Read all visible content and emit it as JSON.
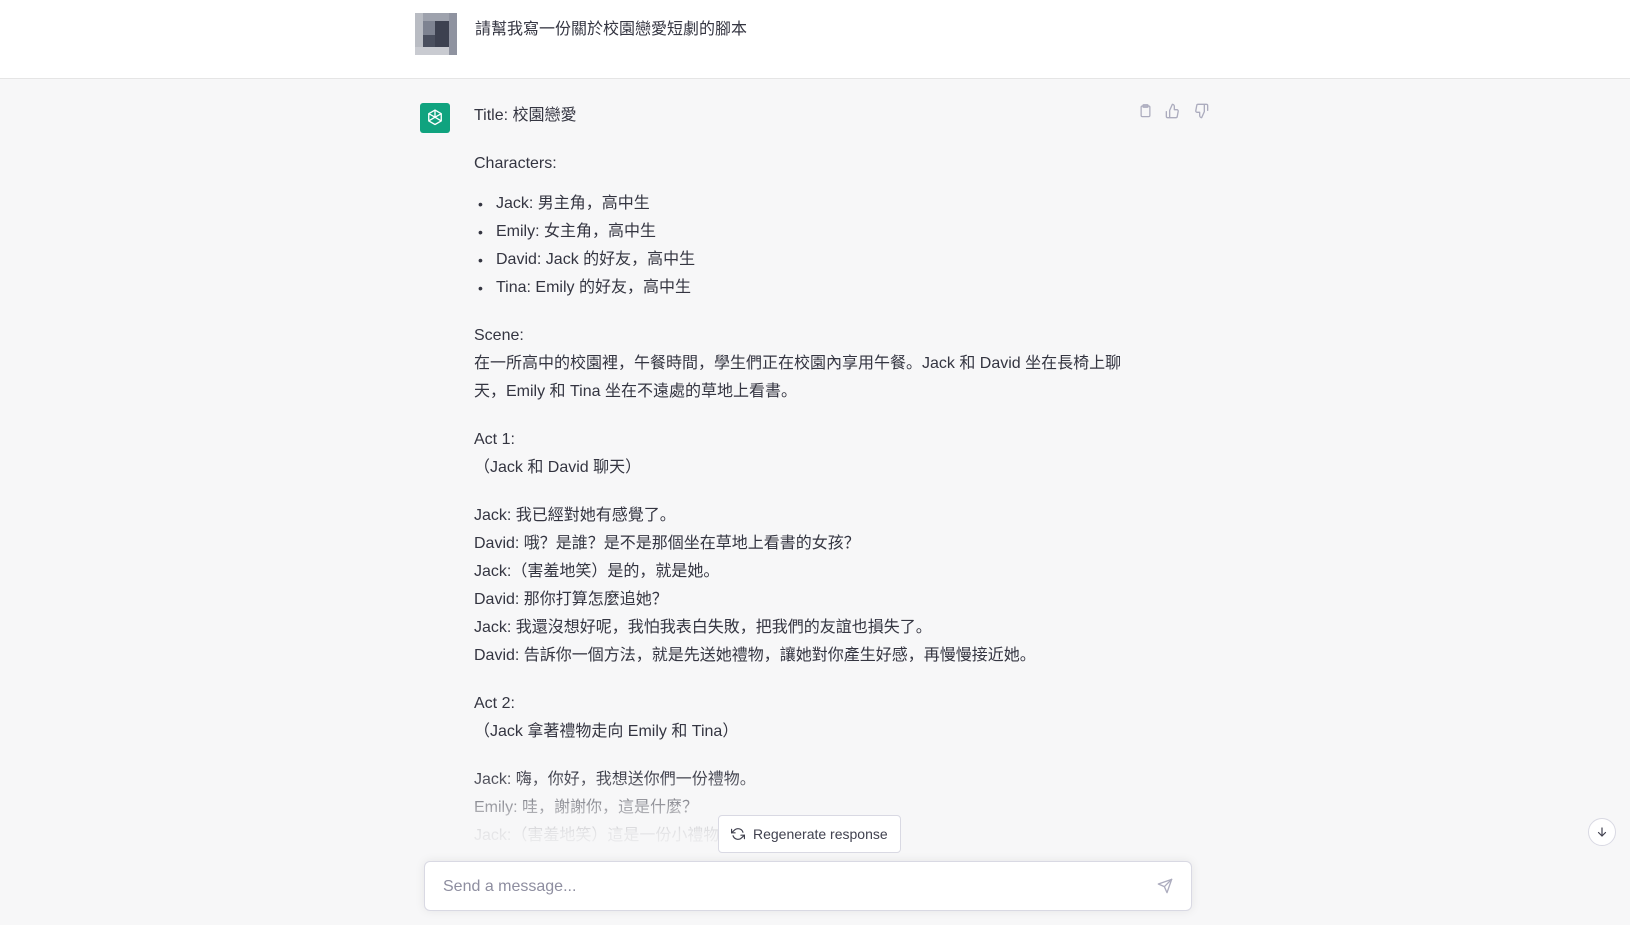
{
  "user_message": {
    "text": "請幫我寫一份關於校園戀愛短劇的腳本"
  },
  "assistant_message": {
    "title_line": "Title: 校園戀愛",
    "characters_heading": "Characters:",
    "characters": [
      "Jack: 男主角，高中生",
      "Emily: 女主角，高中生",
      "David: Jack 的好友，高中生",
      "Tina: Emily 的好友，高中生"
    ],
    "scene_heading": "Scene:",
    "scene_line1": "在一所高中的校園裡，午餐時間，學生們正在校園內享用午餐。Jack 和 David 坐在長椅上聊",
    "scene_line2": "天，Emily 和 Tina 坐在不遠處的草地上看書。",
    "act1_heading": "Act 1:",
    "act1_direction": "（Jack 和 David 聊天）",
    "act1_lines": [
      "Jack: 我已經對她有感覺了。",
      "David: 哦？是誰？是不是那個坐在草地上看書的女孩？",
      "Jack:（害羞地笑）是的，就是她。",
      "David: 那你打算怎麼追她？",
      "Jack: 我還沒想好呢，我怕我表白失敗，把我們的友誼也損失了。",
      "David: 告訴你一個方法，就是先送她禮物，讓她對你產生好感，再慢慢接近她。"
    ],
    "act2_heading": "Act 2:",
    "act2_direction": "（Jack 拿著禮物走向 Emily 和 Tina）",
    "act2_lines": [
      "Jack: 嗨，你好，我想送你們一份禮物。",
      "Emily: 哇，謝謝你，這是什麼？",
      "Jack:（害羞地笑）這是一份小禮物"
    ]
  },
  "controls": {
    "regenerate_label": "Regenerate response",
    "composer_placeholder": "Send a message..."
  },
  "icons": {
    "copy": "clipboard-icon",
    "like": "thumbs-up-icon",
    "dislike": "thumbs-down-icon",
    "regenerate": "refresh-icon",
    "send": "paper-plane-icon",
    "scroll": "arrow-down-icon",
    "assistant_avatar": "openai-logo-icon"
  },
  "colors": {
    "brand_green": "#10a37f",
    "assistant_bg": "#f7f7f8"
  }
}
